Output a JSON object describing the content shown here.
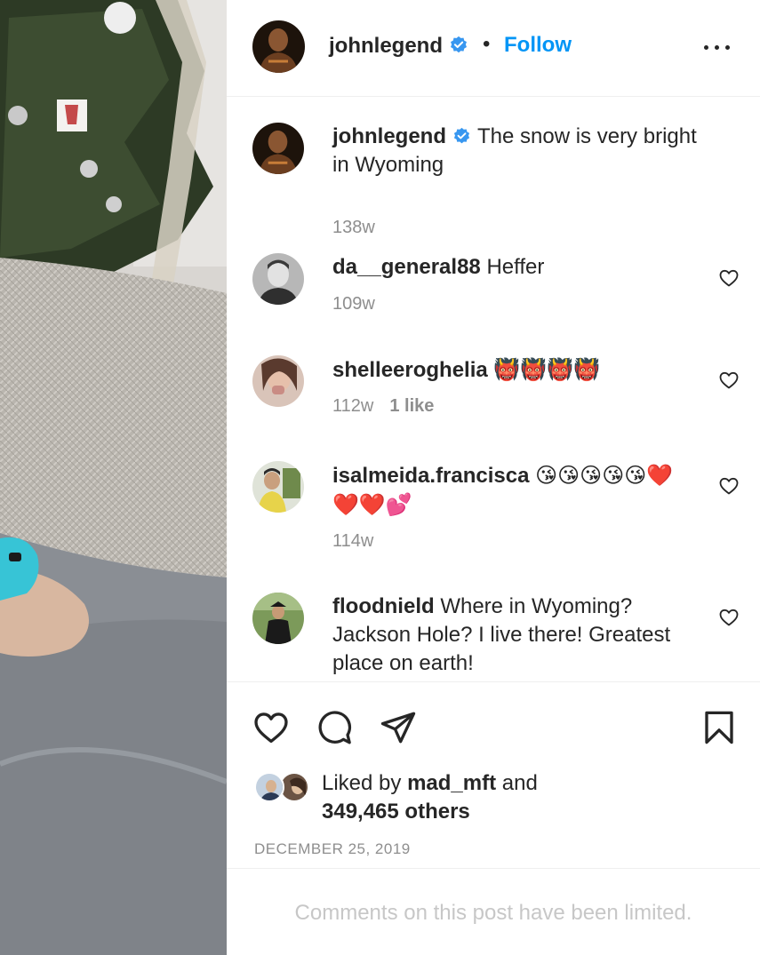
{
  "post": {
    "author": "johnlegend",
    "follow_label": "Follow",
    "separator": "•",
    "date": "DECEMBER 25, 2019"
  },
  "caption": {
    "user": "johnlegend",
    "text": "The snow is very bright in Wyoming",
    "age": "138w"
  },
  "comments": [
    {
      "user": "da__general88",
      "text": "Heffer",
      "age": "109w",
      "likes": ""
    },
    {
      "user": "shelleeroghelia",
      "text": "👹👹👹👹",
      "age": "112w",
      "likes": "1 like"
    },
    {
      "user": "isalmeida.francisca",
      "text": "😘😘😘😘😘❤️❤️❤️💕",
      "age": "114w",
      "likes": ""
    },
    {
      "user": "floodnield",
      "text": "Where in Wyoming? Jackson Hole? I live there! Greatest place on earth!",
      "age": "",
      "likes": ""
    }
  ],
  "likes": {
    "prefix": "Liked by",
    "user": "mad_mft",
    "joiner": "and",
    "others": "349,465 others"
  },
  "footer": {
    "limited_text": "Comments on this post have been limited."
  },
  "icons": {
    "verified": "verified-badge-icon",
    "more": "more-options-icon",
    "like": "heart-icon",
    "comment": "comment-bubble-icon",
    "share": "paper-plane-icon",
    "save": "bookmark-icon"
  },
  "colors": {
    "follow": "#0095f6",
    "verified": "#3897f0",
    "text": "#262626",
    "muted": "#8e8e8e",
    "limited": "#c7c7c7"
  }
}
